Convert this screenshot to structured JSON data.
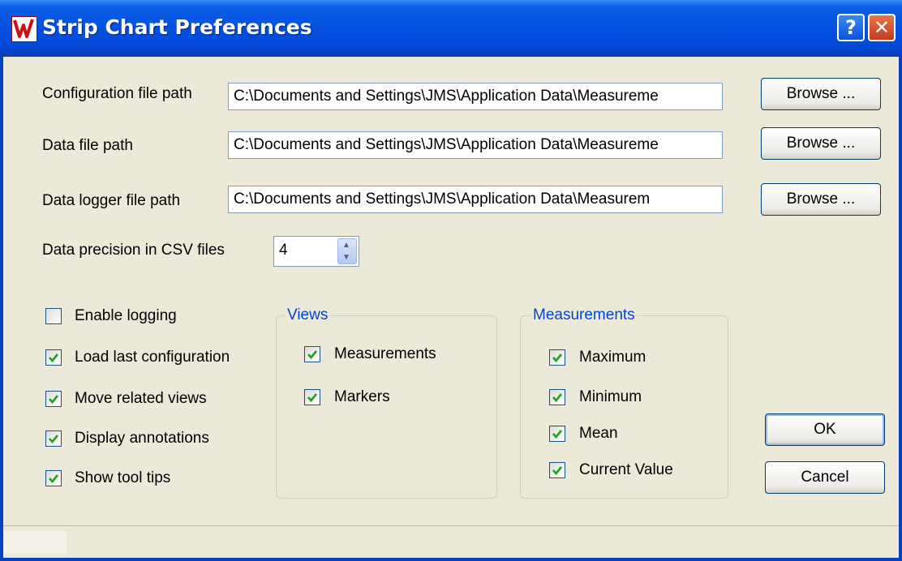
{
  "window": {
    "title": "Strip Chart Preferences",
    "help_label": "?",
    "close_label": "✕",
    "app_icon_color": "#cc1010"
  },
  "paths": [
    {
      "label": "Configuration file path",
      "value": "C:\\Documents and Settings\\JMS\\Application Data\\Measureme",
      "browse": "Browse ..."
    },
    {
      "label": "Data file path",
      "value": "C:\\Documents and Settings\\JMS\\Application Data\\Measureme",
      "browse": "Browse ..."
    },
    {
      "label": "Data logger file path",
      "value": "C:\\Documents and Settings\\JMS\\Application Data\\Measurem",
      "browse": "Browse ..."
    }
  ],
  "precision": {
    "label": "Data precision in CSV files",
    "value": "4"
  },
  "options": [
    {
      "label": "Enable logging",
      "checked": false
    },
    {
      "label": "Load last configuration",
      "checked": true
    },
    {
      "label": "Move related views",
      "checked": true
    },
    {
      "label": "Display annotations",
      "checked": true
    },
    {
      "label": "Show tool tips",
      "checked": true
    }
  ],
  "views": {
    "title": "Views",
    "items": [
      {
        "label": "Measurements",
        "checked": true
      },
      {
        "label": "Markers",
        "checked": true
      }
    ]
  },
  "measurements": {
    "title": "Measurements",
    "items": [
      {
        "label": "Maximum",
        "checked": true
      },
      {
        "label": "Minimum",
        "checked": true
      },
      {
        "label": "Mean",
        "checked": true
      },
      {
        "label": "Current Value",
        "checked": true
      }
    ]
  },
  "buttons": {
    "ok": "OK",
    "cancel": "Cancel"
  },
  "colors": {
    "title_bar": "#0550e0",
    "group_title": "#0046d5",
    "check": "#21a121"
  }
}
